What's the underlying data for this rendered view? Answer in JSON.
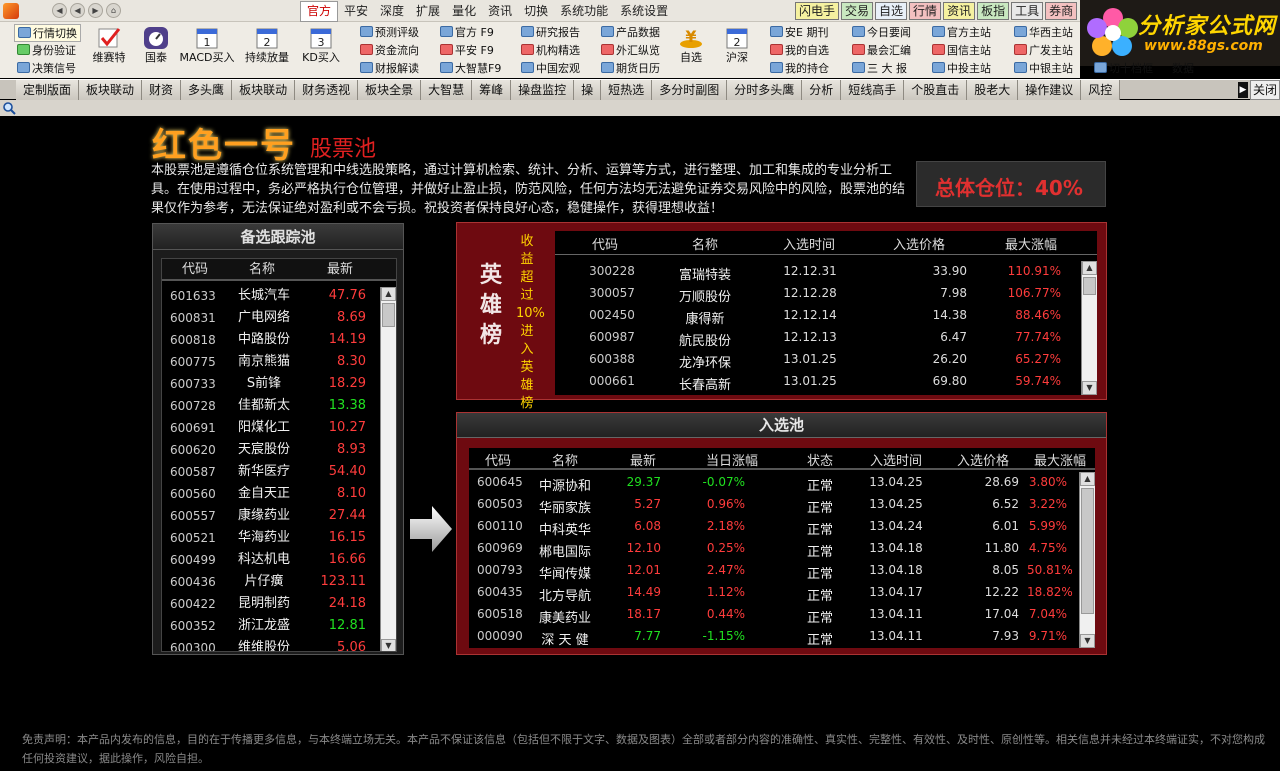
{
  "menubar": {
    "items": [
      "官方",
      "平安",
      "深度",
      "扩展",
      "量化",
      "资讯",
      "切换",
      "系统功能",
      "系统设置"
    ],
    "quick_tabs": [
      {
        "label": "闪电手",
        "bg": "#f5f1a0"
      },
      {
        "label": "交易",
        "bg": "#c9e8c0"
      },
      {
        "label": "自选",
        "bg": "#e8f0f8"
      },
      {
        "label": "行情",
        "bg": "#f3c0c0"
      },
      {
        "label": "资讯",
        "bg": "#f5f1a0"
      },
      {
        "label": "板指",
        "bg": "#c9e8c0"
      },
      {
        "label": "工具",
        "bg": "#e8e8e8"
      },
      {
        "label": "券商",
        "bg": "#f3c0c0"
      }
    ]
  },
  "brand": {
    "name": "分析家公式网",
    "url": "www.88gs.com"
  },
  "toolbar": {
    "left_buttons": [
      "行情切换",
      "身份验证",
      "决策信号"
    ],
    "icon_buttons": [
      "维赛特",
      "国泰",
      "MACD买入",
      "持续放量",
      "KD买入"
    ],
    "icon_dates": [
      "1",
      "2",
      "3"
    ],
    "col1": [
      "预测评级",
      "资金流向",
      "财报解读"
    ],
    "col2": [
      "官方    F9",
      "平安    F9",
      "大智慧F9"
    ],
    "col3": [
      "研究报告",
      "机构精选",
      "中国宏观"
    ],
    "col4": [
      "产品数据",
      "外汇纵览",
      "期货日历"
    ],
    "mid_icon_buttons": [
      "自选",
      "沪深"
    ],
    "mid_icon_date": "2",
    "col5": [
      "安E 期刊",
      "我的自选",
      "我的持仓"
    ],
    "col6": [
      "今日要闻",
      "最会汇编",
      "三 大 报"
    ],
    "col7": [
      "官方主站",
      "国信主站",
      "中投主站"
    ],
    "col8": [
      "华西主站",
      "广发主站",
      "中银主站"
    ],
    "extra": [
      "切十档框",
      "数据"
    ]
  },
  "tabs": [
    "定制版面",
    "板块联动",
    "财资",
    "多头鹰",
    "板块联动",
    "财务透视",
    "板块全景",
    "大智慧",
    "筹峰",
    "操盘监控",
    "操",
    "短热选",
    "多分时副图",
    "分时多头鹰",
    "分析",
    "短线高手",
    "个股直击",
    "股老大",
    "操作建议",
    "风控"
  ],
  "tab_close": "关闭",
  "page": {
    "title": "红色一号",
    "subtitle": "股票池",
    "intro": "本股票池是遵循仓位系统管理和中线选股策略，通过计算机检索、统计、分析、运算等方式，进行整理、加工和集成的专业分析工具。在使用过程中，务必严格执行仓位管理，并做好止盈止损，防范风险，任何方法均无法避免证券交易风险中的风险，股票池的结果仅作为参考，无法保证绝对盈利或不会亏损。祝投资者保持良好心态，稳健操作，获得理想收益！",
    "position_label": "总体仓位：",
    "position_value": "40%"
  },
  "watch": {
    "title": "备选跟踪池",
    "headers": [
      "代码",
      "名称",
      "最新"
    ],
    "rows": [
      {
        "code": "601633",
        "name": "长城汽车",
        "price": "47.76",
        "dir": "red"
      },
      {
        "code": "600831",
        "name": "广电网络",
        "price": "8.69",
        "dir": "red"
      },
      {
        "code": "600818",
        "name": "中路股份",
        "price": "14.19",
        "dir": "red"
      },
      {
        "code": "600775",
        "name": "南京熊猫",
        "price": "8.30",
        "dir": "red"
      },
      {
        "code": "600733",
        "name": "S前锋",
        "price": "18.29",
        "dir": "red"
      },
      {
        "code": "600728",
        "name": "佳都新太",
        "price": "13.38",
        "dir": "green"
      },
      {
        "code": "600691",
        "name": "阳煤化工",
        "price": "10.27",
        "dir": "red"
      },
      {
        "code": "600620",
        "name": "天宸股份",
        "price": "8.93",
        "dir": "red"
      },
      {
        "code": "600587",
        "name": "新华医疗",
        "price": "54.40",
        "dir": "red"
      },
      {
        "code": "600560",
        "name": "金自天正",
        "price": "8.10",
        "dir": "red"
      },
      {
        "code": "600557",
        "name": "康缘药业",
        "price": "27.44",
        "dir": "red"
      },
      {
        "code": "600521",
        "name": "华海药业",
        "price": "16.15",
        "dir": "red"
      },
      {
        "code": "600499",
        "name": "科达机电",
        "price": "16.66",
        "dir": "red"
      },
      {
        "code": "600436",
        "name": "片仔癀",
        "price": "123.11",
        "dir": "red"
      },
      {
        "code": "600422",
        "name": "昆明制药",
        "price": "24.18",
        "dir": "red"
      },
      {
        "code": "600352",
        "name": "浙江龙盛",
        "price": "12.81",
        "dir": "green"
      },
      {
        "code": "600300",
        "name": "维维股份",
        "price": "5.06",
        "dir": "red"
      }
    ]
  },
  "heroes": {
    "label": "英雄榜",
    "note": "收益超过10%进入英雄榜",
    "headers": [
      "代码",
      "名称",
      "入选时间",
      "入选价格",
      "最大涨幅"
    ],
    "rows": [
      {
        "code": "300228",
        "name": "富瑞特装",
        "date": "12.12.31",
        "price": "33.90",
        "gain": "110.91%"
      },
      {
        "code": "300057",
        "name": "万顺股份",
        "date": "12.12.28",
        "price": "7.98",
        "gain": "106.77%"
      },
      {
        "code": "002450",
        "name": "康得新",
        "date": "12.12.14",
        "price": "14.38",
        "gain": "88.46%"
      },
      {
        "code": "600987",
        "name": "航民股份",
        "date": "12.12.13",
        "price": "6.47",
        "gain": "77.74%"
      },
      {
        "code": "600388",
        "name": "龙净环保",
        "date": "13.01.25",
        "price": "26.20",
        "gain": "65.27%"
      },
      {
        "code": "000661",
        "name": "长春高新",
        "date": "13.01.25",
        "price": "69.80",
        "gain": "59.74%"
      }
    ]
  },
  "pool": {
    "title": "入选池",
    "headers": [
      "代码",
      "名称",
      "最新",
      "当日涨幅",
      "状态",
      "入选时间",
      "入选价格",
      "最大涨幅"
    ],
    "rows": [
      {
        "code": "600645",
        "name": "中源协和",
        "price": "29.37",
        "chg": "-0.07%",
        "status": "正常",
        "date": "13.04.25",
        "in": "28.69",
        "gain": "3.80%",
        "dir": "green"
      },
      {
        "code": "600503",
        "name": "华丽家族",
        "price": "5.27",
        "chg": "0.96%",
        "status": "正常",
        "date": "13.04.25",
        "in": "6.52",
        "gain": "3.22%",
        "dir": "red"
      },
      {
        "code": "600110",
        "name": "中科英华",
        "price": "6.08",
        "chg": "2.18%",
        "status": "正常",
        "date": "13.04.24",
        "in": "6.01",
        "gain": "5.99%",
        "dir": "red"
      },
      {
        "code": "600969",
        "name": "郴电国际",
        "price": "12.10",
        "chg": "0.25%",
        "status": "正常",
        "date": "13.04.18",
        "in": "11.80",
        "gain": "4.75%",
        "dir": "red"
      },
      {
        "code": "000793",
        "name": "华闻传媒",
        "price": "12.01",
        "chg": "2.47%",
        "status": "正常",
        "date": "13.04.18",
        "in": "8.05",
        "gain": "50.81%",
        "dir": "red"
      },
      {
        "code": "600435",
        "name": "北方导航",
        "price": "14.49",
        "chg": "1.12%",
        "status": "正常",
        "date": "13.04.17",
        "in": "12.22",
        "gain": "18.82%",
        "dir": "red"
      },
      {
        "code": "600518",
        "name": "康美药业",
        "price": "18.17",
        "chg": "0.44%",
        "status": "正常",
        "date": "13.04.11",
        "in": "17.04",
        "gain": "7.04%",
        "dir": "red"
      },
      {
        "code": "000090",
        "name": "深 天 健",
        "price": "7.77",
        "chg": "-1.15%",
        "status": "正常",
        "date": "13.04.11",
        "in": "7.93",
        "gain": "9.71%",
        "dir": "green"
      }
    ]
  },
  "disclaimer": "免责声明：本产品内发布的信息，目的在于传播更多信息，与本终端立场无关。本产品不保证该信息（包括但不限于文字、数据及图表）全部或者部分内容的准确性、真实性、完整性、有效性、及时性、原创性等。相关信息并未经过本终端证实，不对您构成任何投资建议，据此操作，风险自担。"
}
